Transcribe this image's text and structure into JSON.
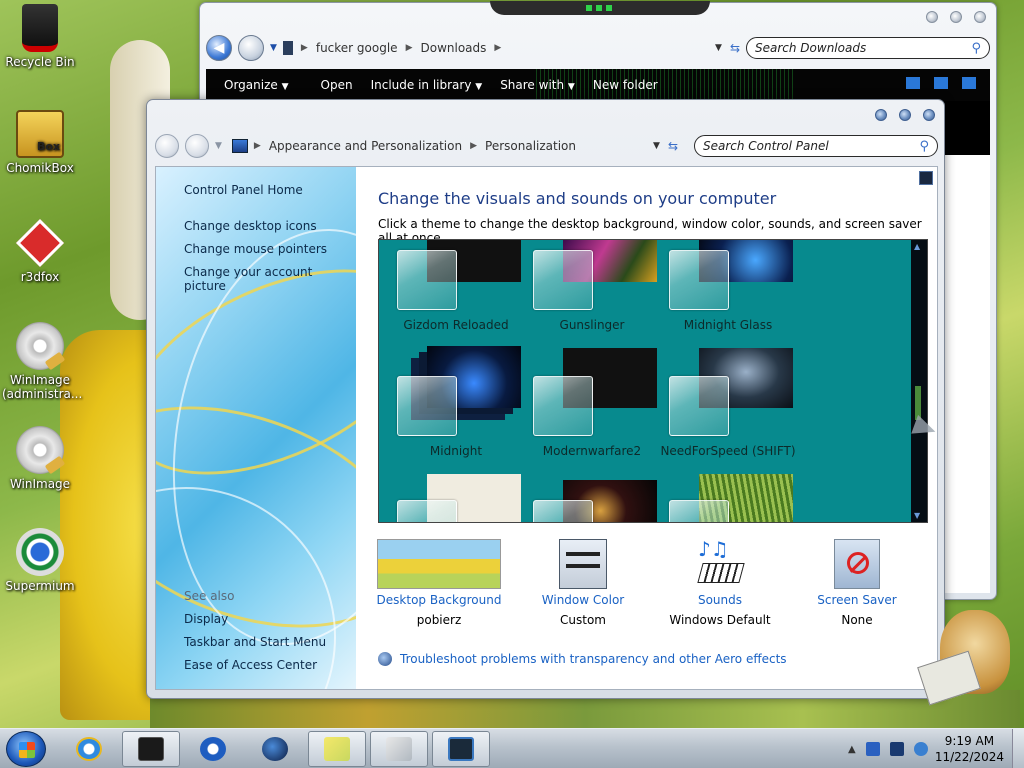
{
  "desktop": {
    "icons": [
      {
        "label": "Recycle Bin"
      },
      {
        "label": "ChomikBox",
        "badge": "Box"
      },
      {
        "label": "r3dfox"
      },
      {
        "label": "WinImage (administra..."
      },
      {
        "label": "WinImage"
      },
      {
        "label": "Supermium"
      }
    ]
  },
  "explorer": {
    "breadcrumb": [
      "fucker google",
      "Downloads"
    ],
    "search_placeholder": "Search Downloads",
    "toolbar": [
      "Organize",
      "Open",
      "Include in library",
      "Share with",
      "New folder"
    ],
    "toolbar_dropdowns": [
      "▼",
      "",
      "▼",
      "▼",
      ""
    ]
  },
  "control_panel": {
    "breadcrumb": [
      "Appearance and Personalization",
      "Personalization"
    ],
    "search_placeholder": "Search Control Panel",
    "sidebar": {
      "home": "Control Panel Home",
      "links": [
        "Change desktop icons",
        "Change mouse pointers",
        "Change your account picture"
      ],
      "see_also_label": "See also",
      "see_also": [
        "Display",
        "Taskbar and Start Menu",
        "Ease of Access Center"
      ]
    },
    "title": "Change the visuals and sounds on your computer",
    "subtitle": "Click a theme to change the desktop background, window color, sounds, and screen saver all at once.",
    "themes": [
      {
        "name": "Gizdom Reloaded"
      },
      {
        "name": "Gunslinger"
      },
      {
        "name": "Midnight Glass"
      },
      {
        "name": "Midnight"
      },
      {
        "name": "Modernwarfare2"
      },
      {
        "name": "NeedForSpeed (SHIFT)"
      },
      {
        "name": ""
      },
      {
        "name": ""
      },
      {
        "name": ""
      }
    ],
    "settings": [
      {
        "link": "Desktop Background",
        "value": "pobierz"
      },
      {
        "link": "Window Color",
        "value": "Custom"
      },
      {
        "link": "Sounds",
        "value": "Windows Default"
      },
      {
        "link": "Screen Saver",
        "value": "None"
      }
    ],
    "troubleshoot": "Troubleshoot problems with transparency and other Aero effects",
    "theme_area_color": "#078a8e"
  },
  "taskbar": {
    "time": "9:19 AM",
    "date": "11/22/2024",
    "apps": [
      "start-orb",
      "internet-explorer-icon",
      "dark-app-icon",
      "media-player-icon",
      "globe-icon",
      "sticky-notes-icon",
      "control-panel-icon",
      "monitor-icon"
    ]
  }
}
